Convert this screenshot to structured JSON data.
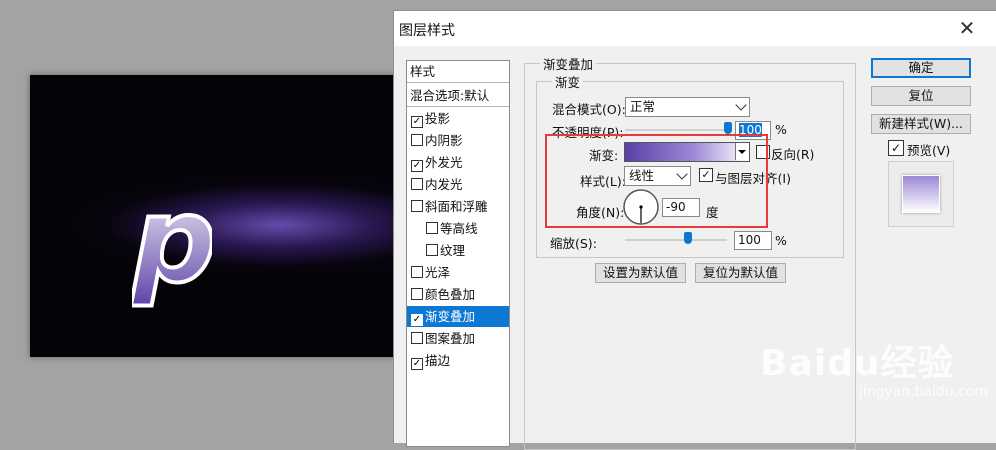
{
  "dialog": {
    "title": "图层样式",
    "close_glyph": "✕"
  },
  "styles": {
    "header": "样式",
    "blend_default": "混合选项:默认",
    "items": [
      {
        "label": "投影",
        "checked": true
      },
      {
        "label": "内阴影",
        "checked": false
      },
      {
        "label": "外发光",
        "checked": true
      },
      {
        "label": "内发光",
        "checked": false
      },
      {
        "label": "斜面和浮雕",
        "checked": false
      },
      {
        "label": "等高线",
        "checked": false
      },
      {
        "label": "纹理",
        "checked": false
      },
      {
        "label": "光泽",
        "checked": false
      },
      {
        "label": "颜色叠加",
        "checked": false
      },
      {
        "label": "渐变叠加",
        "checked": true,
        "selected": true
      },
      {
        "label": "图案叠加",
        "checked": false
      },
      {
        "label": "描边",
        "checked": true
      }
    ]
  },
  "panel": {
    "group_title": "渐变叠加",
    "sub_group_title": "渐变",
    "blend_mode_label": "混合模式(O):",
    "blend_mode_value": "正常",
    "opacity_label": "不透明度(P):",
    "opacity_value": "100",
    "opacity_unit": "%",
    "gradient_label": "渐变:",
    "reverse_label": "反向(R)",
    "reverse_checked": false,
    "style_label": "样式(L):",
    "style_value": "线性",
    "align_label": "与图层对齐(I)",
    "align_checked": true,
    "angle_label": "角度(N):",
    "angle_value": "-90",
    "angle_unit": "度",
    "scale_label": "缩放(S):",
    "scale_value": "100",
    "scale_unit": "%",
    "set_default_button": "设置为默认值",
    "reset_default_button": "复位为默认值"
  },
  "actions": {
    "ok": "确定",
    "reset": "复位",
    "new_style": "新建样式(W)...",
    "preview_label": "预览(V)",
    "preview_checked": true
  },
  "canvas": {
    "letter": "p"
  },
  "watermark": {
    "brand": "Baidu经验",
    "url": "jingyan.baidu.com"
  },
  "colors": {
    "accent": "#0c78d4",
    "highlight_box": "#e53b3b",
    "gradient_start": "#5a3fa6",
    "gradient_end": "#ffffff"
  },
  "icons": [
    "close-icon",
    "checkmark-icon",
    "chevron-down-icon",
    "slider-thumb-icon",
    "angle-dial-icon"
  ]
}
